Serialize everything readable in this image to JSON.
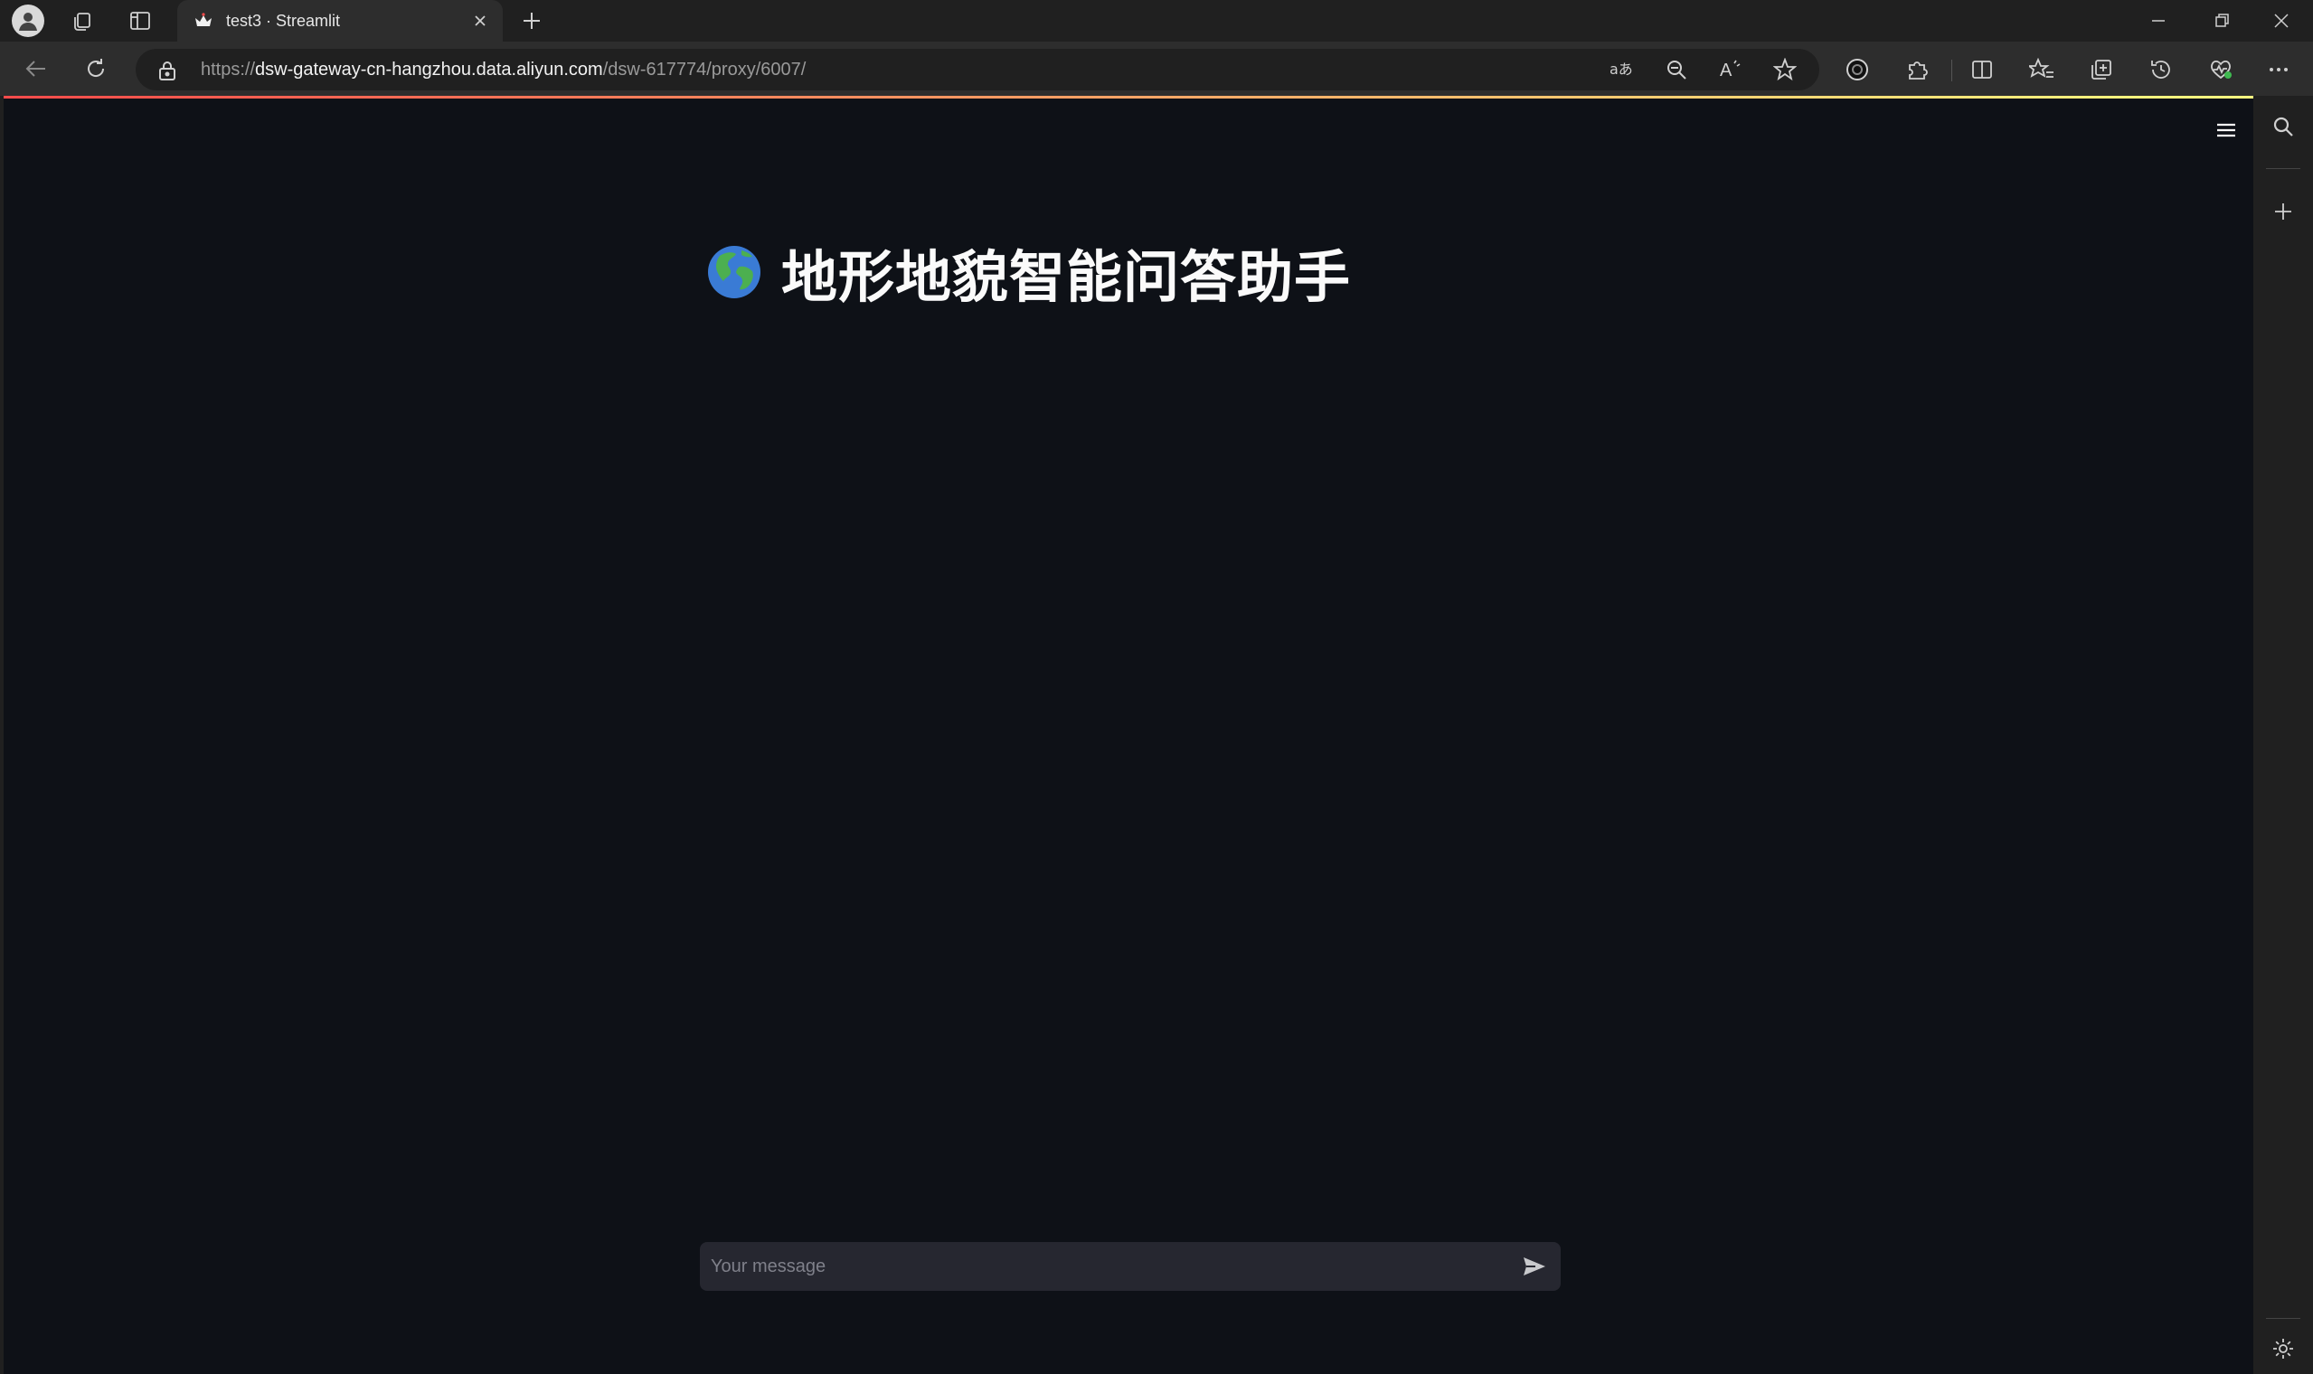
{
  "browser": {
    "tab": {
      "title": "test3 · Streamlit",
      "favicon": "streamlit-crown-icon"
    },
    "address": {
      "scheme": "https://",
      "host": "dsw-gateway-cn-hangzhou.data.aliyun.com",
      "path": "/dsw-617774/proxy/6007/"
    },
    "toolbar_icons": [
      "translate-icon",
      "zoom-out-icon",
      "read-aloud-icon",
      "favorite-star-icon",
      "extension-circle-icon",
      "extensions-puzzle-icon",
      "split-screen-icon",
      "favorites-icon",
      "collections-icon",
      "history-icon",
      "browser-essentials-icon",
      "more-icon"
    ],
    "sidebar_icons": [
      "search-icon",
      "add-icon",
      "settings-icon"
    ]
  },
  "app": {
    "title_emoji": "🌍",
    "title": "地形地貌智能问答助手",
    "chat_input": {
      "placeholder": "Your message",
      "value": ""
    }
  },
  "colors": {
    "page_bg": "#0e1117",
    "input_bg": "#262730",
    "chrome_bg": "#202020",
    "toolbar_bg": "#2d2d2d",
    "accent_gradient_start": "#ff4b4b",
    "accent_gradient_end": "#fffd80"
  }
}
